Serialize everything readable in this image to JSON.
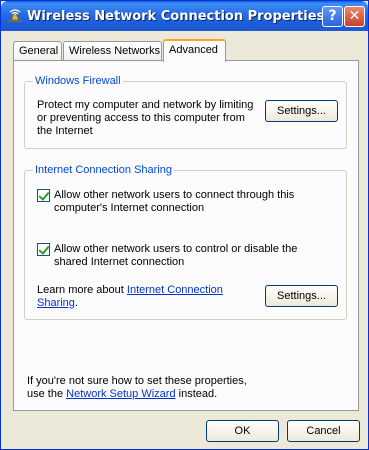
{
  "window": {
    "title": "Wireless Network Connection Properties"
  },
  "titlebar": {
    "help_glyph": "?",
    "close_glyph": "✕"
  },
  "tabs": [
    {
      "label": "General"
    },
    {
      "label": "Wireless Networks"
    },
    {
      "label": "Advanced"
    }
  ],
  "firewall": {
    "legend": "Windows Firewall",
    "description": "Protect my computer and network by limiting or preventing access to this computer from the Internet",
    "settings_label": "Settings..."
  },
  "ics": {
    "legend": "Internet Connection Sharing",
    "checkbox1": {
      "label": "Allow other network users to connect through this computer's Internet connection",
      "checked": true
    },
    "checkbox2": {
      "label": "Allow other network users to control or disable the shared Internet connection",
      "checked": true
    },
    "learn_prefix": "Learn more about ",
    "learn_link": "Internet Connection Sharing",
    "learn_suffix": ".",
    "settings_label": "Settings..."
  },
  "footer_note": {
    "prefix": "If you're not sure how to set these properties, use the ",
    "link": "Network Setup Wizard",
    "suffix": " instead."
  },
  "buttons": {
    "ok": "OK",
    "cancel": "Cancel"
  },
  "colors": {
    "titlebar": "#1d5ed9",
    "group_legend": "#0046d5",
    "tab_active_accent": "#f5a623",
    "link": "#0033cc"
  }
}
